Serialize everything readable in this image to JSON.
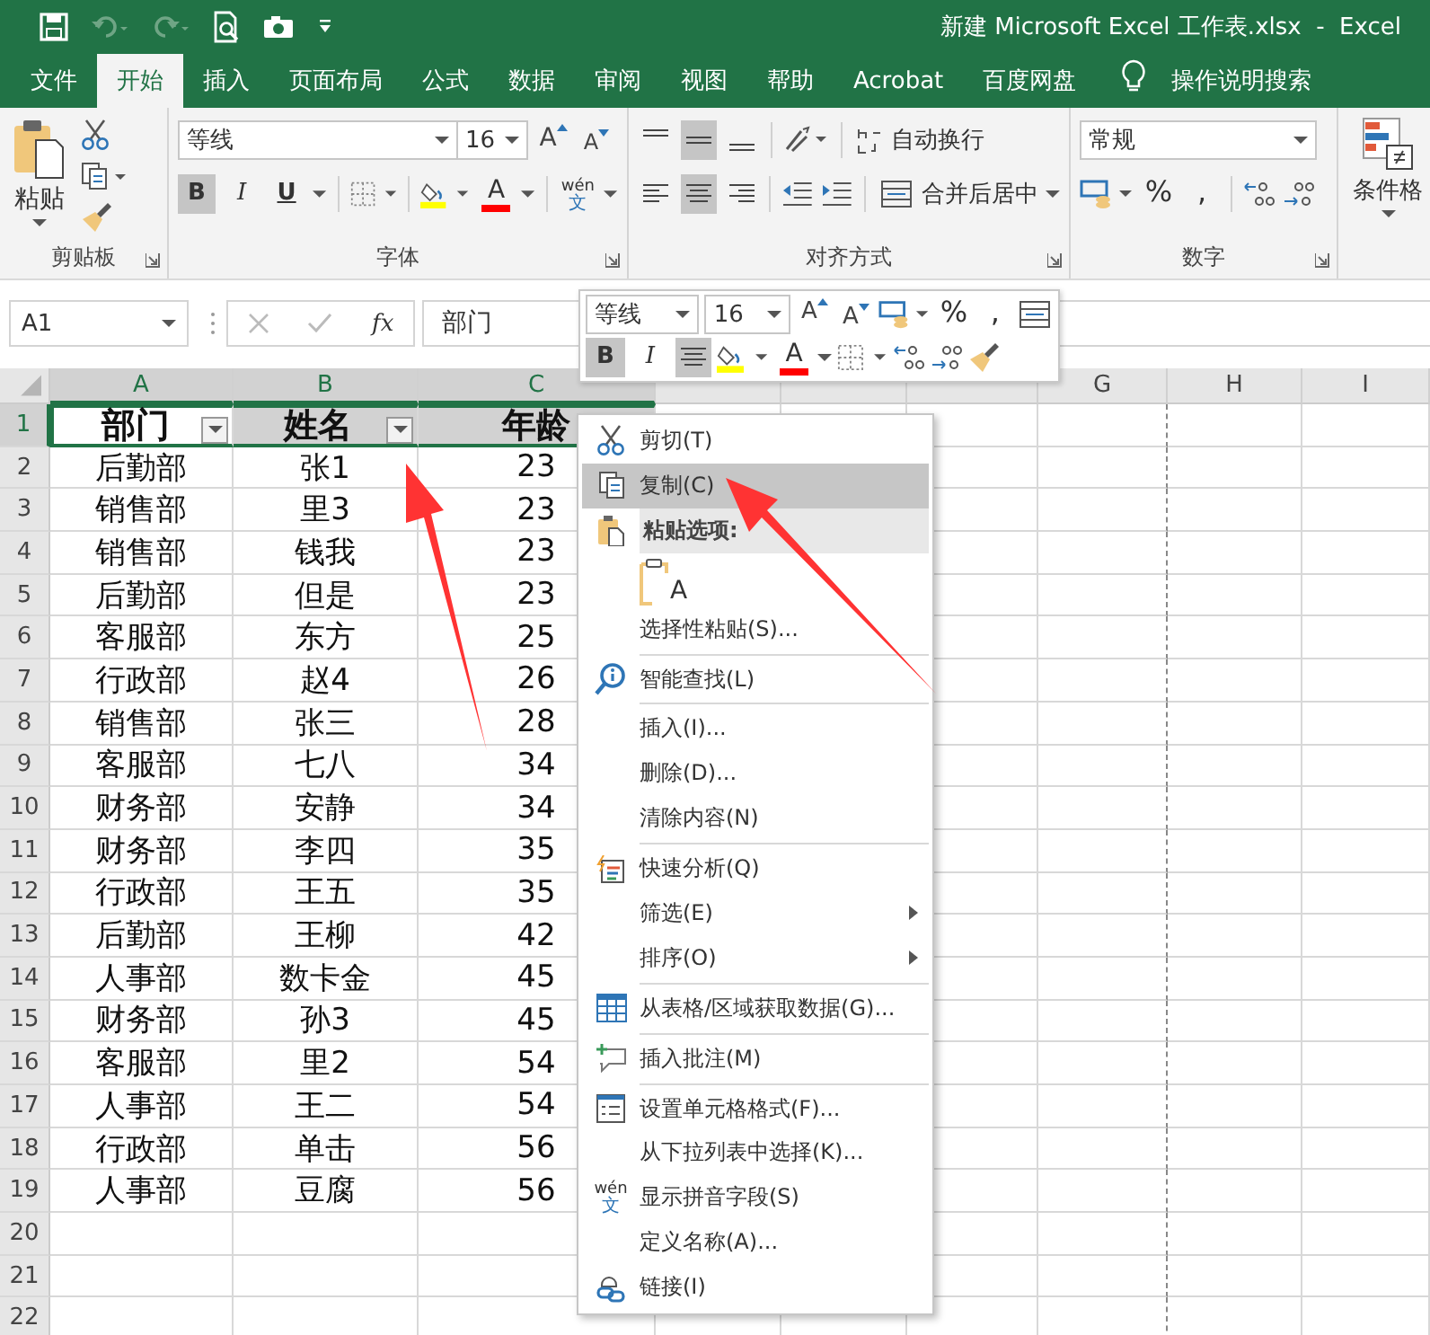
{
  "window": {
    "title": "新建 Microsoft Excel 工作表.xlsx  -  Excel"
  },
  "ribbon_tabs": [
    {
      "label": "文件",
      "selected": false
    },
    {
      "label": "开始",
      "selected": true
    },
    {
      "label": "插入",
      "selected": false
    },
    {
      "label": "页面布局",
      "selected": false
    },
    {
      "label": "公式",
      "selected": false
    },
    {
      "label": "数据",
      "selected": false
    },
    {
      "label": "审阅",
      "selected": false
    },
    {
      "label": "视图",
      "selected": false
    },
    {
      "label": "帮助",
      "selected": false
    },
    {
      "label": "Acrobat",
      "selected": false
    },
    {
      "label": "百度网盘",
      "selected": false
    }
  ],
  "tell_me": "操作说明搜索",
  "clipboard": {
    "paste": "粘贴",
    "group": "剪贴板"
  },
  "font": {
    "name": "等线",
    "size": "16",
    "grow": "A",
    "shrink": "A",
    "font_color": "A",
    "phonetic_top": "wén",
    "phonetic_bottom": "文",
    "group": "字体",
    "styles": [
      {
        "label": "B",
        "selected": true
      },
      {
        "label": "I",
        "selected": false
      },
      {
        "label": "U",
        "selected": false
      }
    ]
  },
  "alignment": {
    "wrap": "自动换行",
    "merge": "合并后居中",
    "group": "对齐方式",
    "vertical": [
      {
        "selected": false
      },
      {
        "selected": true
      },
      {
        "selected": false
      }
    ],
    "horizontal": [
      {
        "selected": false
      },
      {
        "selected": true
      },
      {
        "selected": false
      }
    ]
  },
  "number": {
    "format": "常规",
    "percent": "%",
    "comma": ",",
    "group": "数字"
  },
  "styles_group": {
    "conditional": "条件格"
  },
  "formula_bar": {
    "name_box": "A1",
    "fx": "fx",
    "value": "部门"
  },
  "mini_toolbar": {
    "font": "等线",
    "size": "16",
    "grow": "A",
    "shrink": "A",
    "percent": "%",
    "comma": ",",
    "bold": "B",
    "bold_selected": true,
    "italic": "I",
    "center_selected": true,
    "font_color": "A"
  },
  "sheet": {
    "columns": [
      {
        "label": "A",
        "selected": true
      },
      {
        "label": "B",
        "selected": true
      },
      {
        "label": "C",
        "selected": true
      },
      {
        "selected": false
      },
      {
        "selected": false
      },
      {
        "selected": false
      },
      {
        "label": "G",
        "selected": false
      },
      {
        "label": "H",
        "selected": false
      },
      {
        "label": "I",
        "selected": false
      }
    ],
    "rows": [
      {
        "number": "1",
        "selected": true,
        "cells": [
          {
            "text": "部门",
            "filter": true,
            "active": true
          },
          {
            "text": "姓名",
            "filter": true,
            "active": false
          },
          {
            "text": "年龄",
            "active": false
          }
        ]
      },
      {
        "number": "2",
        "selected": false,
        "cells": [
          {
            "text": "后勤部"
          },
          {
            "text": "张1"
          },
          {
            "text": "23"
          }
        ]
      },
      {
        "number": "3",
        "selected": false,
        "cells": [
          {
            "text": "销售部"
          },
          {
            "text": "里3"
          },
          {
            "text": "23"
          }
        ]
      },
      {
        "number": "4",
        "selected": false,
        "cells": [
          {
            "text": "销售部"
          },
          {
            "text": "钱我"
          },
          {
            "text": "23"
          }
        ]
      },
      {
        "number": "5",
        "selected": false,
        "cells": [
          {
            "text": "后勤部"
          },
          {
            "text": "但是"
          },
          {
            "text": "23"
          }
        ]
      },
      {
        "number": "6",
        "selected": false,
        "cells": [
          {
            "text": "客服部"
          },
          {
            "text": "东方"
          },
          {
            "text": "25"
          }
        ]
      },
      {
        "number": "7",
        "selected": false,
        "cells": [
          {
            "text": "行政部"
          },
          {
            "text": "赵4"
          },
          {
            "text": "26"
          }
        ]
      },
      {
        "number": "8",
        "selected": false,
        "cells": [
          {
            "text": "销售部"
          },
          {
            "text": "张三"
          },
          {
            "text": "28"
          }
        ]
      },
      {
        "number": "9",
        "selected": false,
        "cells": [
          {
            "text": "客服部"
          },
          {
            "text": "七八"
          },
          {
            "text": "34"
          }
        ]
      },
      {
        "number": "10",
        "selected": false,
        "cells": [
          {
            "text": "财务部"
          },
          {
            "text": "安静"
          },
          {
            "text": "34"
          }
        ]
      },
      {
        "number": "11",
        "selected": false,
        "cells": [
          {
            "text": "财务部"
          },
          {
            "text": "李四"
          },
          {
            "text": "35"
          }
        ]
      },
      {
        "number": "12",
        "selected": false,
        "cells": [
          {
            "text": "行政部"
          },
          {
            "text": "王五"
          },
          {
            "text": "35"
          }
        ]
      },
      {
        "number": "13",
        "selected": false,
        "cells": [
          {
            "text": "后勤部"
          },
          {
            "text": "王柳"
          },
          {
            "text": "42"
          }
        ]
      },
      {
        "number": "14",
        "selected": false,
        "cells": [
          {
            "text": "人事部"
          },
          {
            "text": "数卡金"
          },
          {
            "text": "45"
          }
        ]
      },
      {
        "number": "15",
        "selected": false,
        "cells": [
          {
            "text": "财务部"
          },
          {
            "text": "孙3"
          },
          {
            "text": "45"
          }
        ]
      },
      {
        "number": "16",
        "selected": false,
        "cells": [
          {
            "text": "客服部"
          },
          {
            "text": "里2"
          },
          {
            "text": "54"
          }
        ]
      },
      {
        "number": "17",
        "selected": false,
        "cells": [
          {
            "text": "人事部"
          },
          {
            "text": "王二"
          },
          {
            "text": "54"
          }
        ]
      },
      {
        "number": "18",
        "selected": false,
        "cells": [
          {
            "text": "行政部"
          },
          {
            "text": "单击"
          },
          {
            "text": "56"
          }
        ]
      },
      {
        "number": "19",
        "selected": false,
        "cells": [
          {
            "text": "人事部"
          },
          {
            "text": "豆腐"
          },
          {
            "text": "56"
          }
        ]
      },
      {
        "number": "20",
        "selected": false
      },
      {
        "number": "21",
        "selected": false
      },
      {
        "number": "22",
        "selected": false
      }
    ]
  },
  "context_menu": [
    {
      "kind": "item",
      "label": "剪切(T)",
      "highlighted": false
    },
    {
      "kind": "item",
      "label": "复制(C)",
      "highlighted": true
    },
    {
      "kind": "header",
      "label": "粘贴选项:"
    },
    {
      "kind": "paste_options",
      "option": "A"
    },
    {
      "kind": "item",
      "label": "选择性粘贴(S)...",
      "highlighted": false,
      "separator_after": true
    },
    {
      "kind": "item",
      "label": "智能查找(L)",
      "highlighted": false,
      "separator_after": true
    },
    {
      "kind": "item",
      "label": "插入(I)...",
      "highlighted": false
    },
    {
      "kind": "item",
      "label": "删除(D)...",
      "highlighted": false
    },
    {
      "kind": "item",
      "label": "清除内容(N)",
      "highlighted": false,
      "separator_after": true
    },
    {
      "kind": "item",
      "label": "快速分析(Q)",
      "highlighted": false
    },
    {
      "kind": "item",
      "label": "筛选(E)",
      "highlighted": false,
      "submenu": true
    },
    {
      "kind": "item",
      "label": "排序(O)",
      "highlighted": false,
      "submenu": true,
      "separator_after": true
    },
    {
      "kind": "item",
      "label": "从表格/区域获取数据(G)...",
      "highlighted": false,
      "separator_after": true
    },
    {
      "kind": "item",
      "label": "插入批注(M)",
      "highlighted": false,
      "separator_after": true
    },
    {
      "kind": "item",
      "label": "设置单元格格式(F)...",
      "highlighted": false
    },
    {
      "kind": "item",
      "label": "从下拉列表中选择(K)...",
      "highlighted": false
    },
    {
      "kind": "item",
      "label": "显示拼音字段(S)",
      "highlighted": false,
      "phonetic_top": "wén",
      "phonetic_bottom": "文"
    },
    {
      "kind": "item",
      "label": "定义名称(A)...",
      "highlighted": false
    },
    {
      "kind": "item",
      "label": "链接(I)",
      "highlighted": false
    }
  ]
}
